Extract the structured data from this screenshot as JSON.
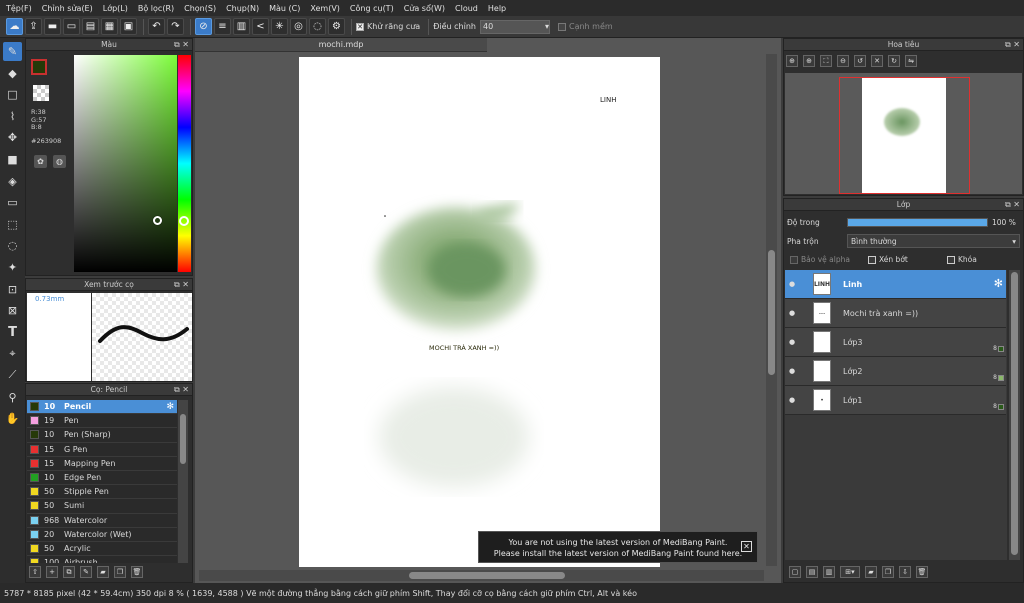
{
  "menu": [
    "Tệp(F)",
    "Chỉnh sửa(E)",
    "Lớp(L)",
    "Bộ lọc(R)",
    "Chọn(S)",
    "Chụp(N)",
    "Màu (C)",
    "Xem(V)",
    "Công cụ(T)",
    "Cửa sổ(W)",
    "Cloud",
    "Help"
  ],
  "toolbar": {
    "antialias_label": "Khử răng cưa",
    "adjust_label": "Điều chỉnh",
    "adjust_value": "40",
    "smooth_label": "Cạnh mềm"
  },
  "color_panel": {
    "title": "Màu",
    "r": "R:38",
    "g": "G:57",
    "b": "B:8",
    "hex": "#263908",
    "accent": "#263908"
  },
  "preview_panel": {
    "title": "Xem trước cọ",
    "size": "0.73mm"
  },
  "brush_panel": {
    "title": "Cọ: Pencil",
    "brushes": [
      {
        "size": "10",
        "name": "Pencil",
        "color": "#263908"
      },
      {
        "size": "19",
        "name": "Pen",
        "color": "#f5a0e0"
      },
      {
        "size": "10",
        "name": "Pen (Sharp)",
        "color": "#263908"
      },
      {
        "size": "15",
        "name": "G Pen",
        "color": "#e83030"
      },
      {
        "size": "15",
        "name": "Mapping Pen",
        "color": "#e83030"
      },
      {
        "size": "10",
        "name": "Edge Pen",
        "color": "#22a022"
      },
      {
        "size": "50",
        "name": "Stipple Pen",
        "color": "#f0d820"
      },
      {
        "size": "50",
        "name": "Sumi",
        "color": "#f0d820"
      },
      {
        "size": "968",
        "name": "Watercolor",
        "color": "#7ad0f0"
      },
      {
        "size": "20",
        "name": "Watercolor (Wet)",
        "color": "#7ad0f0"
      },
      {
        "size": "50",
        "name": "Acrylic",
        "color": "#f0d820"
      },
      {
        "size": "100",
        "name": "Airbrush",
        "color": "#f0d820"
      }
    ]
  },
  "document": {
    "tab": "mochi.mdp",
    "text_top": "LINH",
    "text_mid": "MOCHI TRÀ XANH =))"
  },
  "notification": {
    "line1": "You are not using the latest version of MediBang Paint.",
    "line2": "Please install the latest version of MediBang Paint found here."
  },
  "navigator": {
    "title": "Hoa tiêu"
  },
  "layer_panel": {
    "title": "Lớp",
    "opacity_label": "Độ trong",
    "opacity_value": "100 %",
    "opacity_fraction": 1.0,
    "blend_label": "Pha trộn",
    "blend_value": "Bình thường",
    "protect_alpha": "Bảo vệ alpha",
    "clip": "Xén bớt",
    "lock": "Khóa",
    "layers": [
      {
        "name": "Linh",
        "thumb": "LINH",
        "selected": true
      },
      {
        "name": "Mochi trà xanh =))",
        "thumb": "---",
        "selected": false
      },
      {
        "name": "Lớp3",
        "thumb": "",
        "selected": false
      },
      {
        "name": "Lớp2",
        "thumb": "",
        "selected": false
      },
      {
        "name": "Lớp1",
        "thumb": "•",
        "selected": false
      }
    ]
  },
  "status": {
    "text": "5787 * 8185 pixel  (42 * 59.4cm)  350 dpi  8 %  ( 1639, 4588 )  Vẽ một đường thẳng bằng cách giữ phím Shift, Thay đổi cỡ cọ bằng cách giữ phím Ctrl, Alt và kéo"
  }
}
